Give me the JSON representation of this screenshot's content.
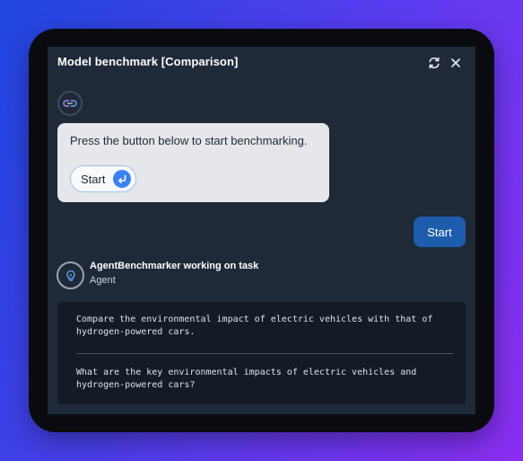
{
  "window": {
    "title": "Model benchmark [Comparison]",
    "refresh_icon": "refresh-icon",
    "close_icon": "close-icon"
  },
  "bot_message": {
    "avatar_icon": "link-bot-icon",
    "text": "Press the button below to start benchmarking.",
    "button_label": "Start",
    "button_icon": "enter-return-icon"
  },
  "user_message": {
    "text": "Start"
  },
  "agent": {
    "avatar_icon": "lightbulb-icon",
    "name": "AgentBenchmarker working on task",
    "role": "Agent"
  },
  "tasks": [
    "Compare the environmental impact of electric vehicles with that of hydrogen-powered cars.",
    "What are the key environmental impacts of electric vehicles and hydrogen-powered cars?"
  ],
  "colors": {
    "accent": "#3b82f6",
    "user_bubble": "#1e5cae",
    "panel_bg": "#1f2937",
    "task_bg": "#141b27"
  }
}
